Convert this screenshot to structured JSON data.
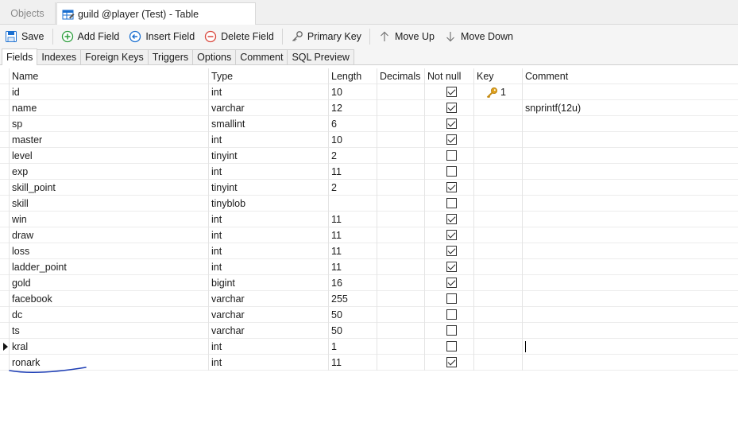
{
  "window_tabs": {
    "objects": "Objects",
    "active": "guild @player (Test) - Table"
  },
  "toolbar": {
    "save": "Save",
    "add_field": "Add Field",
    "insert_field": "Insert Field",
    "delete_field": "Delete Field",
    "primary_key": "Primary Key",
    "move_up": "Move Up",
    "move_down": "Move Down"
  },
  "subtabs": [
    "Fields",
    "Indexes",
    "Foreign Keys",
    "Triggers",
    "Options",
    "Comment",
    "SQL Preview"
  ],
  "columns": {
    "name": "Name",
    "type": "Type",
    "length": "Length",
    "decimals": "Decimals",
    "not_null": "Not null",
    "key": "Key",
    "comment": "Comment"
  },
  "rows": [
    {
      "name": "id",
      "type": "int",
      "length": "10",
      "decimals": "",
      "not_null": true,
      "key": "1",
      "comment": ""
    },
    {
      "name": "name",
      "type": "varchar",
      "length": "12",
      "decimals": "",
      "not_null": true,
      "key": "",
      "comment": "snprintf(12u)"
    },
    {
      "name": "sp",
      "type": "smallint",
      "length": "6",
      "decimals": "",
      "not_null": true,
      "key": "",
      "comment": ""
    },
    {
      "name": "master",
      "type": "int",
      "length": "10",
      "decimals": "",
      "not_null": true,
      "key": "",
      "comment": ""
    },
    {
      "name": "level",
      "type": "tinyint",
      "length": "2",
      "decimals": "",
      "not_null": false,
      "key": "",
      "comment": ""
    },
    {
      "name": "exp",
      "type": "int",
      "length": "11",
      "decimals": "",
      "not_null": false,
      "key": "",
      "comment": ""
    },
    {
      "name": "skill_point",
      "type": "tinyint",
      "length": "2",
      "decimals": "",
      "not_null": true,
      "key": "",
      "comment": ""
    },
    {
      "name": "skill",
      "type": "tinyblob",
      "length": "",
      "decimals": "",
      "not_null": false,
      "key": "",
      "comment": ""
    },
    {
      "name": "win",
      "type": "int",
      "length": "11",
      "decimals": "",
      "not_null": true,
      "key": "",
      "comment": ""
    },
    {
      "name": "draw",
      "type": "int",
      "length": "11",
      "decimals": "",
      "not_null": true,
      "key": "",
      "comment": ""
    },
    {
      "name": "loss",
      "type": "int",
      "length": "11",
      "decimals": "",
      "not_null": true,
      "key": "",
      "comment": ""
    },
    {
      "name": "ladder_point",
      "type": "int",
      "length": "11",
      "decimals": "",
      "not_null": true,
      "key": "",
      "comment": ""
    },
    {
      "name": "gold",
      "type": "bigint",
      "length": "16",
      "decimals": "",
      "not_null": true,
      "key": "",
      "comment": ""
    },
    {
      "name": "facebook",
      "type": "varchar",
      "length": "255",
      "decimals": "",
      "not_null": false,
      "key": "",
      "comment": ""
    },
    {
      "name": "dc",
      "type": "varchar",
      "length": "50",
      "decimals": "",
      "not_null": false,
      "key": "",
      "comment": ""
    },
    {
      "name": "ts",
      "type": "varchar",
      "length": "50",
      "decimals": "",
      "not_null": false,
      "key": "",
      "comment": ""
    },
    {
      "name": "kral",
      "type": "int",
      "length": "1",
      "decimals": "",
      "not_null": false,
      "key": "",
      "comment": "",
      "current": true
    },
    {
      "name": "ronark",
      "type": "int",
      "length": "11",
      "decimals": "",
      "not_null": true,
      "key": "",
      "comment": ""
    }
  ],
  "colors": {
    "accent_blue": "#1a6fd0",
    "add_green": "#2e9e3e",
    "delete_red": "#d9463b",
    "key_gold": "#e0a21c",
    "annotation_ink": "#1f3fb5"
  }
}
